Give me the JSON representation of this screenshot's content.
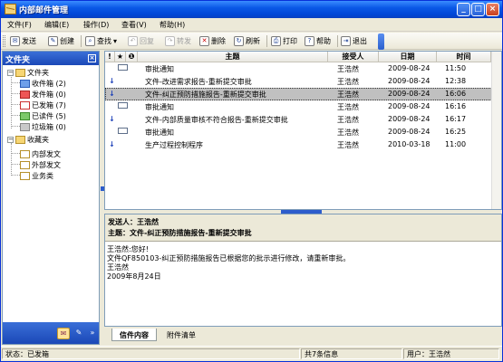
{
  "window": {
    "title": "内部邮件管理"
  },
  "menu": [
    "文件(F)",
    "编辑(E)",
    "操作(D)",
    "查看(V)",
    "帮助(H)"
  ],
  "toolbar": {
    "send": "发送",
    "create": "创建",
    "find": "查找",
    "reply": "回复",
    "forward": "转发",
    "delete": "删除",
    "refresh": "刷新",
    "print": "打印",
    "help": "帮助",
    "exit": "退出"
  },
  "folders": {
    "header": "文件夹",
    "root": "文件夹",
    "items": [
      "收件箱 (2)",
      "发件箱 (0)",
      "已发箱 (7)",
      "已读件 (5)",
      "垃圾箱 (0)"
    ],
    "favorites": "收藏夹",
    "fav_items": [
      "内部发文",
      "外部发文",
      "业务类"
    ]
  },
  "list": {
    "columns": {
      "flag": "!",
      "star": "★",
      "attach": "❶",
      "subject": "主题",
      "recipient": "接受人",
      "date": "日期",
      "time": "时间"
    },
    "rows": [
      {
        "subject": "审批通知",
        "recipient": "王浩然",
        "date": "2009-08-24",
        "time": "11:50",
        "icon": "mail"
      },
      {
        "subject": "文件-改进需求报告-重新提交审批",
        "recipient": "王浩然",
        "date": "2009-08-24",
        "time": "12:38",
        "icon": "down"
      },
      {
        "subject": "文件-纠正预防措施报告-重新提交审批",
        "recipient": "王浩然",
        "date": "2009-08-24",
        "time": "16:06",
        "icon": "down"
      },
      {
        "subject": "审批通知",
        "recipient": "王浩然",
        "date": "2009-08-24",
        "time": "16:16",
        "icon": "mail"
      },
      {
        "subject": "文件-内部质量审核不符合报告-重新提交审批",
        "recipient": "王浩然",
        "date": "2009-08-24",
        "time": "16:17",
        "icon": "down"
      },
      {
        "subject": "审批通知",
        "recipient": "王浩然",
        "date": "2009-08-24",
        "time": "16:25",
        "icon": "mail"
      },
      {
        "subject": "生产过程控制程序",
        "recipient": "王浩然",
        "date": "2010-03-18",
        "time": "11:00",
        "icon": "down"
      }
    ]
  },
  "preview": {
    "sender": "发送人：王浩然",
    "subject": "主题：文件-纠正预防措施报告-重新提交审批",
    "body": [
      "王浩然:您好!",
      "文件QF850103-纠正预防措施报告已根据您的批示进行修改，请重新审批。",
      "王浩然",
      "2009年8月24日"
    ]
  },
  "tabs": [
    "信件内容",
    "附件清单"
  ],
  "status": {
    "state": "状态：已发箱",
    "count": "共7条信息",
    "user": "用户：王浩然"
  },
  "colors": {
    "title_bar": "#0a58e6",
    "folder_header": "#1b48b7",
    "selected_row": "#c0c0c0"
  }
}
